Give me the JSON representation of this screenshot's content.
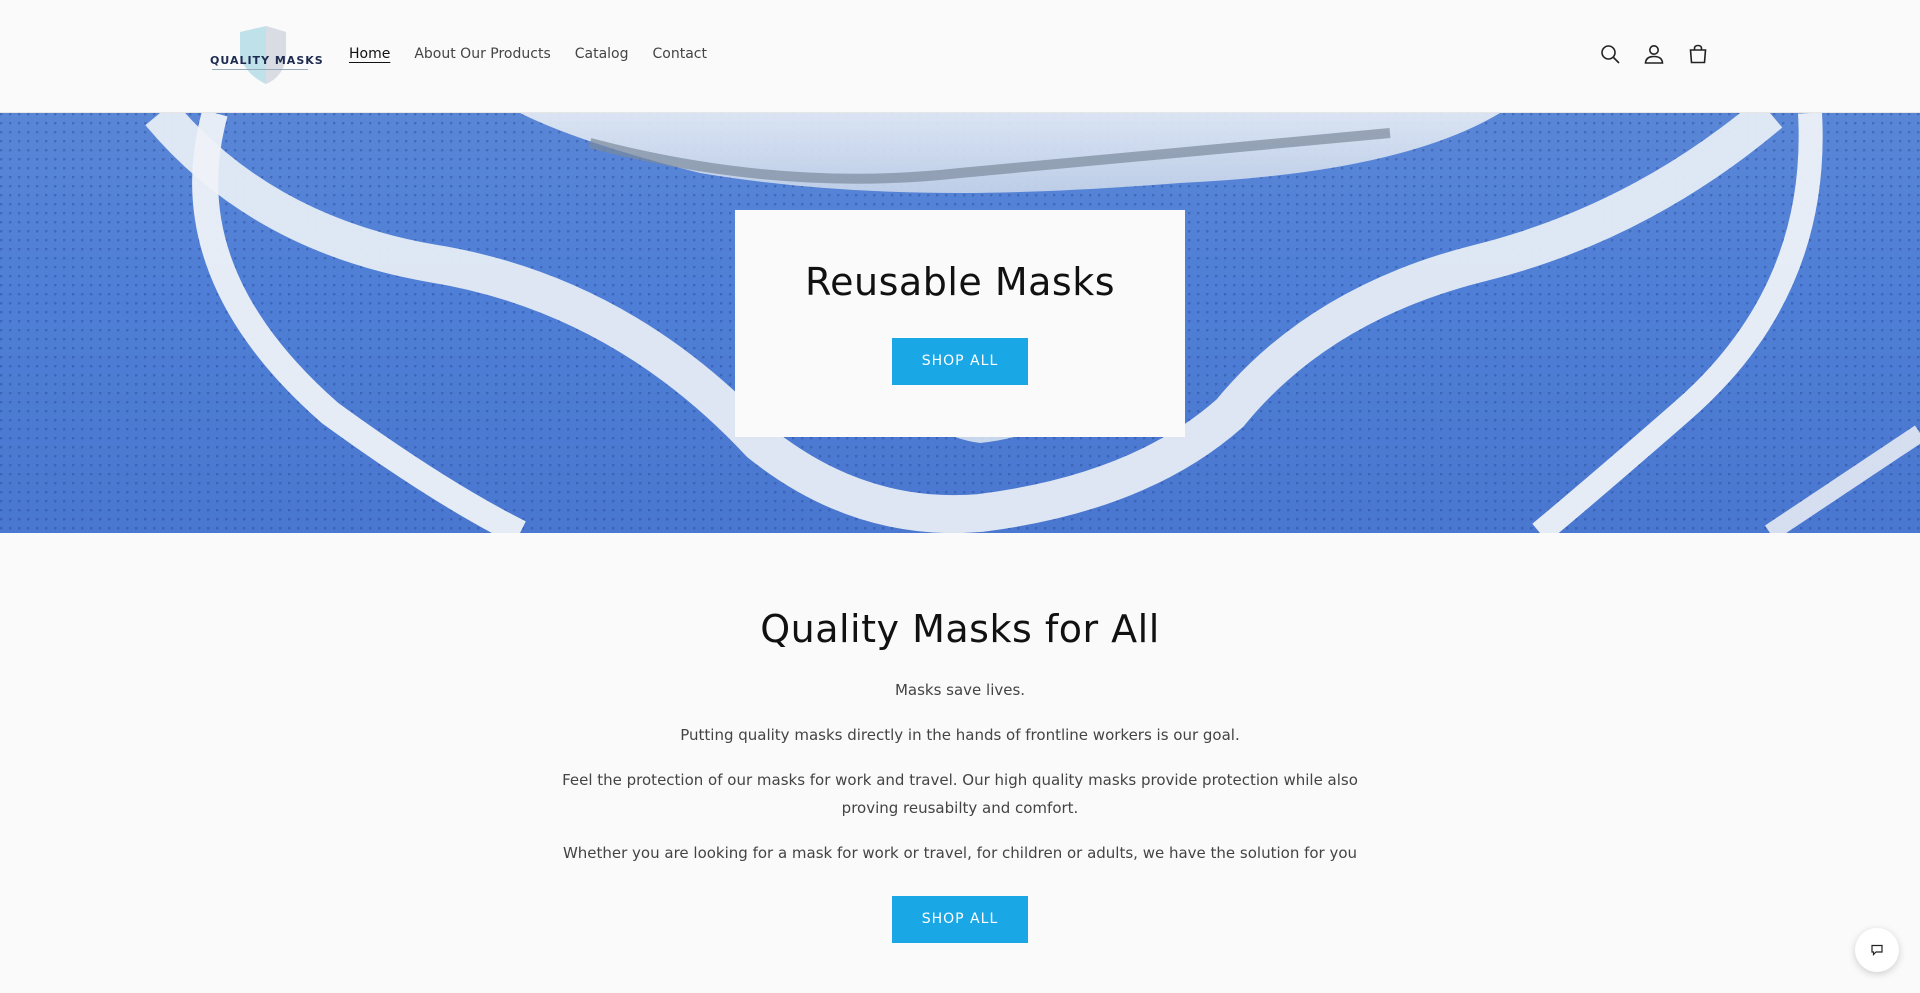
{
  "header": {
    "logo_text": "QUALITY MASKS",
    "nav": [
      {
        "label": "Home",
        "active": true
      },
      {
        "label": "About Our Products"
      },
      {
        "label": "Catalog"
      },
      {
        "label": "Contact"
      }
    ],
    "icons": [
      "search-icon",
      "account-icon",
      "cart-icon"
    ]
  },
  "hero": {
    "title": "Reusable Masks",
    "button_label": "SHOP ALL"
  },
  "main": {
    "title": "Quality Masks for All",
    "paragraphs": [
      "Masks save lives.",
      "Putting quality masks directly in the hands of frontline workers is our goal.",
      "Feel the protection of our masks for work and travel. Our high quality masks provide protection while also proving reusabilty and comfort.",
      "Whether you are looking for a mask for work or travel, for children or adults, we have the solution for you"
    ],
    "button_label": "SHOP ALL"
  },
  "chat": {
    "icon": "chat-icon"
  },
  "colors": {
    "accent": "#1aa7e6",
    "background": "#fafafa",
    "hero_blue": "#4f7fd6"
  }
}
